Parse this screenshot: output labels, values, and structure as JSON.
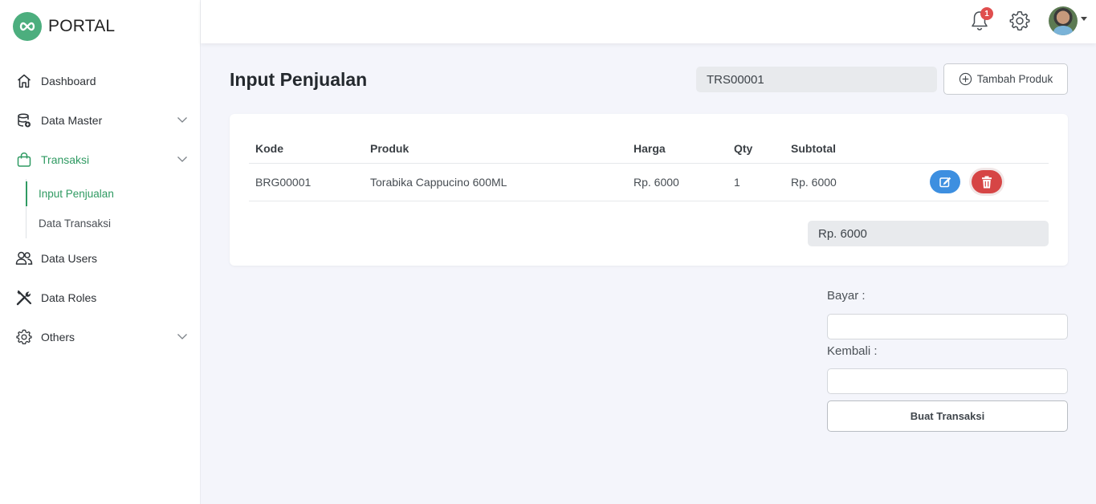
{
  "brand": {
    "name": "PORTAL",
    "logo_icon": "infinity-icon",
    "accent": "#4cae7e"
  },
  "sidebar": {
    "items": [
      {
        "label": "Dashboard",
        "icon": "home-icon"
      },
      {
        "label": "Data Master",
        "icon": "database-icon"
      },
      {
        "label": "Transaksi",
        "icon": "shopping-bag-icon",
        "active": true
      },
      {
        "label": "Data Users",
        "icon": "users-icon"
      },
      {
        "label": "Data Roles",
        "icon": "tools-icon"
      },
      {
        "label": "Others",
        "icon": "gear-icon"
      }
    ],
    "transaksi_sub": [
      {
        "label": "Input Penjualan",
        "active": true
      },
      {
        "label": "Data Transaksi"
      }
    ]
  },
  "topbar": {
    "notification_count": "1"
  },
  "main": {
    "title": "Input Penjualan",
    "transaction_code": "TRS00001",
    "add_product_label": "Tambah Produk",
    "table": {
      "columns": [
        "Kode",
        "Produk",
        "Harga",
        "Qty",
        "Subtotal"
      ],
      "rows": [
        {
          "kode": "BRG00001",
          "produk": "Torabika Cappucino 600ML",
          "harga": "Rp. 6000",
          "qty": "1",
          "subtotal": "Rp. 6000"
        }
      ]
    },
    "total": "Rp. 6000"
  },
  "payment": {
    "bayar_label": "Bayar :",
    "bayar_value": "",
    "kembali_label": "Kembali :",
    "kembali_value": "",
    "submit_label": "Buat Transaksi"
  },
  "colors": {
    "edit": "#3d8fe0",
    "delete": "#d64545",
    "active_nav": "#2f9a62"
  }
}
